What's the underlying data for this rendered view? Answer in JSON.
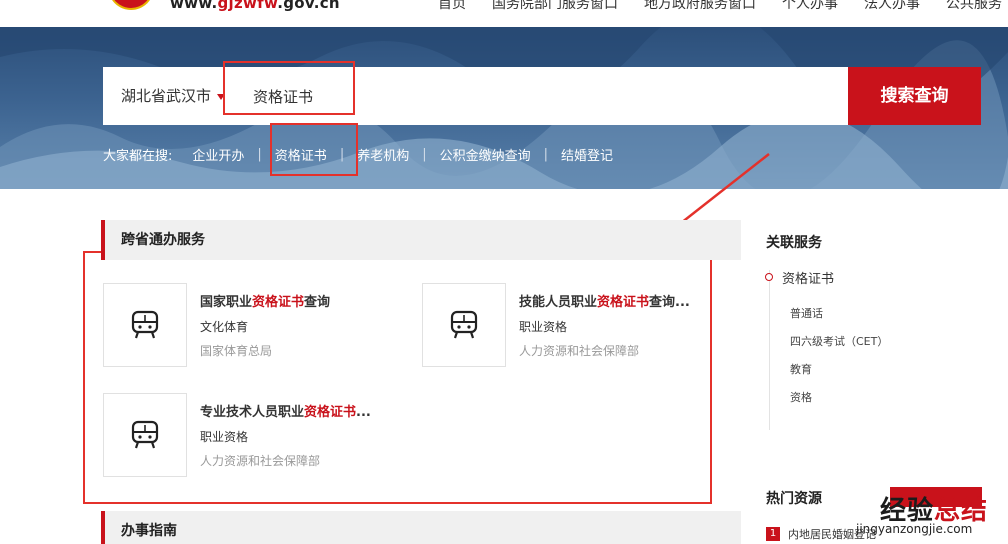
{
  "header": {
    "url_prefix": "www.",
    "url_red": "gjzwfw",
    "url_suffix": ".gov.cn",
    "nav": [
      "首页",
      "国务院部门服务窗口",
      "地方政府服务窗口",
      "个人办事",
      "法人办事",
      "公共服务"
    ]
  },
  "search": {
    "region": "湖北省武汉市",
    "query": "资格证书",
    "button_label": "搜索查询"
  },
  "hot_search": {
    "label": "大家都在搜:",
    "items": [
      "企业开办",
      "资格证书",
      "养老机构",
      "公积金缴纳查询",
      "结婚登记"
    ]
  },
  "section_cross": {
    "title": "跨省通办服务",
    "cards": [
      {
        "title_pre": "国家职业",
        "title_hl": "资格证书",
        "title_post": "查询",
        "category": "文化体育",
        "dept": "国家体育总局",
        "icon": "bus-icon"
      },
      {
        "title_pre": "技能人员职业",
        "title_hl": "资格证书",
        "title_post": "查询...",
        "category": "职业资格",
        "dept": "人力资源和社会保障部",
        "icon": "bus-icon"
      },
      {
        "title_pre": "专业技术人员职业",
        "title_hl": "资格证书",
        "title_post": "...",
        "category": "职业资格",
        "dept": "人力资源和社会保障部",
        "icon": "bus-icon"
      }
    ]
  },
  "section_guide": {
    "title": "办事指南"
  },
  "sidebar": {
    "related_title": "关联服务",
    "related_main": "资格证书",
    "related_sub": [
      "普通话",
      "四六级考试（CET）",
      "教育",
      "资格"
    ],
    "hot_title": "热门资源",
    "hot_items": [
      {
        "rank": "1",
        "text": "内地居民婚姻登记"
      }
    ]
  },
  "watermark": {
    "text_a": "经验",
    "text_b": "总结",
    "url": "jingyanzongjie.com"
  },
  "colors": {
    "accent": "#c9121b",
    "annotation": "#e4312b",
    "banner": "#3c6390"
  }
}
